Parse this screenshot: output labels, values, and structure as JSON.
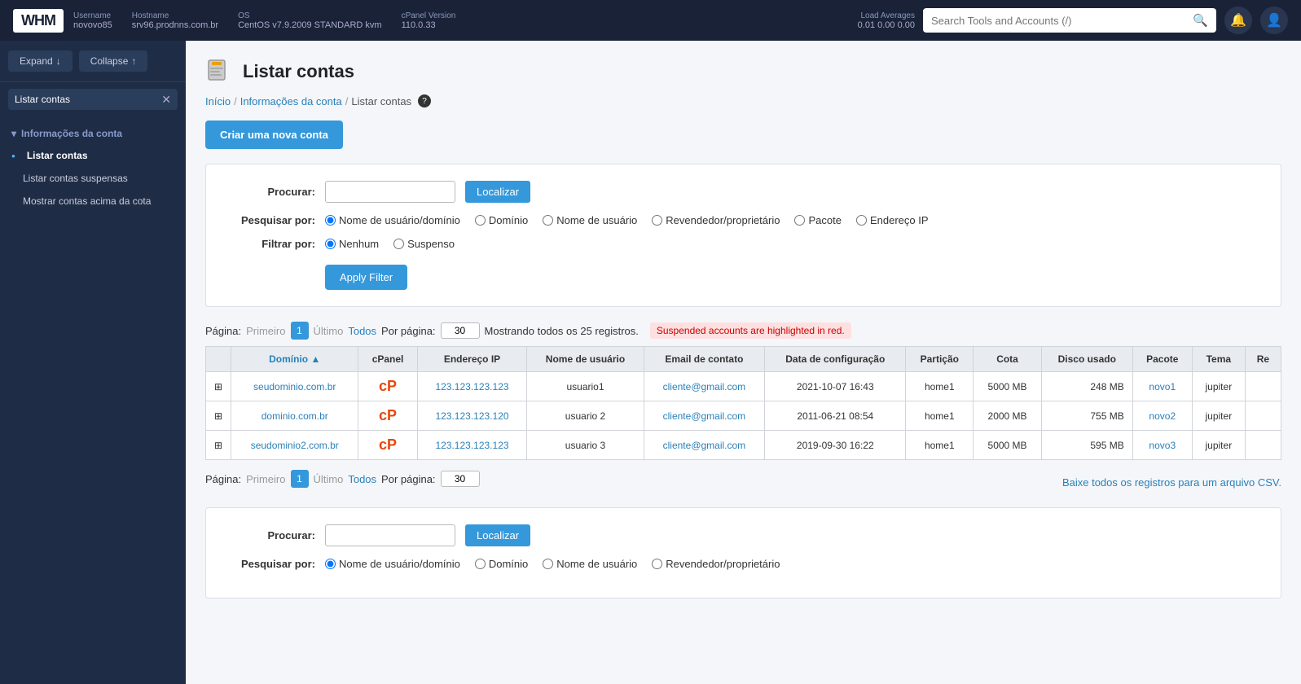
{
  "topbar": {
    "logo": "WHM",
    "meta": {
      "username_label": "Username",
      "username_value": "novovo85",
      "hostname_label": "Hostname",
      "hostname_value": "srv96.prodnns.com.br",
      "os_label": "OS",
      "os_value": "CentOS v7.9.2009 STANDARD kvm",
      "cpanel_label": "cPanel Version",
      "cpanel_value": "110.0.33"
    },
    "load_avg_label": "Load Averages",
    "load_avg_values": "0.01  0.00  0.00",
    "search_placeholder": "Search Tools and Accounts (/)"
  },
  "sidebar": {
    "expand_label": "Expand",
    "collapse_label": "Collapse",
    "search_value": "Listar contas",
    "section_label": "Informações da conta",
    "items": [
      {
        "label": "Listar contas",
        "active": true
      },
      {
        "label": "Listar contas suspensas",
        "active": false
      },
      {
        "label": "Mostrar contas acima da cota",
        "active": false
      }
    ]
  },
  "page": {
    "title": "Listar contas",
    "breadcrumb_home": "Início",
    "breadcrumb_section": "Informações da conta",
    "breadcrumb_current": "Listar contas",
    "create_button": "Criar uma nova conta"
  },
  "filter": {
    "search_label": "Procurar:",
    "search_placeholder": "",
    "localizar_button": "Localizar",
    "search_by_label": "Pesquisar por:",
    "search_by_options": [
      "Nome de usuário/domínio",
      "Domínio",
      "Nome de usuário",
      "Revendedor/proprietário",
      "Pacote",
      "Endereço IP"
    ],
    "filter_by_label": "Filtrar por:",
    "filter_by_options": [
      "Nenhum",
      "Suspenso"
    ],
    "apply_button": "Apply Filter"
  },
  "pagination_top": {
    "page_label": "Página:",
    "first_label": "Primeiro",
    "last_label": "Último",
    "all_label": "Todos",
    "per_page_label": "Por página:",
    "per_page_value": "30",
    "current_page": "1",
    "showing_text": "Mostrando todos os 25 registros.",
    "suspended_notice": "Suspended accounts are highlighted in red."
  },
  "table": {
    "columns": [
      "",
      "Domínio",
      "cPanel",
      "Endereço IP",
      "Nome de usuário",
      "Email de contato",
      "Data de configuração",
      "Partição",
      "Cota",
      "Disco usado",
      "Pacote",
      "Tema",
      "Re"
    ],
    "rows": [
      {
        "domain": "seudominio.com.br",
        "ip": "123.123.123.123",
        "username": "usuario1",
        "email": "cliente@gmail.com",
        "setup_date": "2021-10-07 16:43",
        "partition": "home1",
        "quota": "5000 MB",
        "disk_used": "248 MB",
        "package": "novo1",
        "theme": "jupiter"
      },
      {
        "domain": "dominio.com.br",
        "ip": "123.123.123.120",
        "username": "usuario 2",
        "email": "cliente@gmail.com",
        "setup_date": "2011-06-21 08:54",
        "partition": "home1",
        "quota": "2000 MB",
        "disk_used": "755 MB",
        "package": "novo2",
        "theme": "jupiter"
      },
      {
        "domain": "seudominio2.com.br",
        "ip": "123.123.123.123",
        "username": "usuario 3",
        "email": "cliente@gmail.com",
        "setup_date": "2019-09-30 16:22",
        "partition": "home1",
        "quota": "5000 MB",
        "disk_used": "595 MB",
        "package": "novo3",
        "theme": "jupiter"
      }
    ]
  },
  "pagination_bottom": {
    "page_label": "Página:",
    "first_label": "Primeiro",
    "last_label": "Último",
    "all_label": "Todos",
    "per_page_label": "Por página:",
    "per_page_value": "30",
    "current_page": "1",
    "csv_text": "Baixe todos os registros para um arquivo CSV."
  },
  "filter_bottom": {
    "search_label": "Procurar:",
    "localizar_button": "Localizar",
    "search_by_label": "Pesquisar por:",
    "search_by_options": [
      "Nome de usuário/domínio",
      "Domínio",
      "Nome de usuário",
      "Revendedor/proprietário"
    ]
  }
}
